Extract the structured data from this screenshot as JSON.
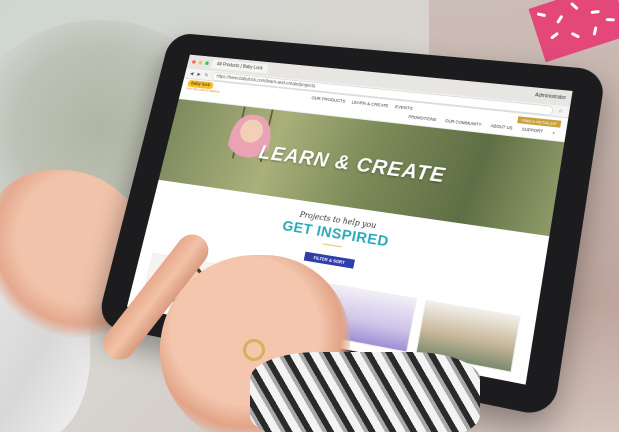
{
  "browser": {
    "tab_title": "All Products | Baby Lock",
    "url": "https://www.babylock.com/learn-and-create/projects",
    "profile_label": "Administrator"
  },
  "site": {
    "logo_text": "baby lock",
    "logo_tagline": "FOR THE LOVE OF SEWING",
    "nav_primary": [
      "OUR PRODUCTS",
      "LEARN & CREATE",
      "EVENTS"
    ],
    "cta_label": "FIND A RETAILER",
    "nav_secondary": [
      "PROMOTIONS",
      "OUR COMMUNITY",
      "ABOUT US",
      "SUPPORT"
    ]
  },
  "hero": {
    "title": "LEARN & CREATE"
  },
  "inspire": {
    "script_line": "Projects to help you",
    "headline": "GET INSPIRED",
    "filter_button": "FILTER & SORT"
  },
  "colors": {
    "accent_teal": "#2aa9b9",
    "button_blue": "#2f3ea8",
    "logo_yellow": "#f4c230",
    "tape_pink": "#e4487a"
  }
}
